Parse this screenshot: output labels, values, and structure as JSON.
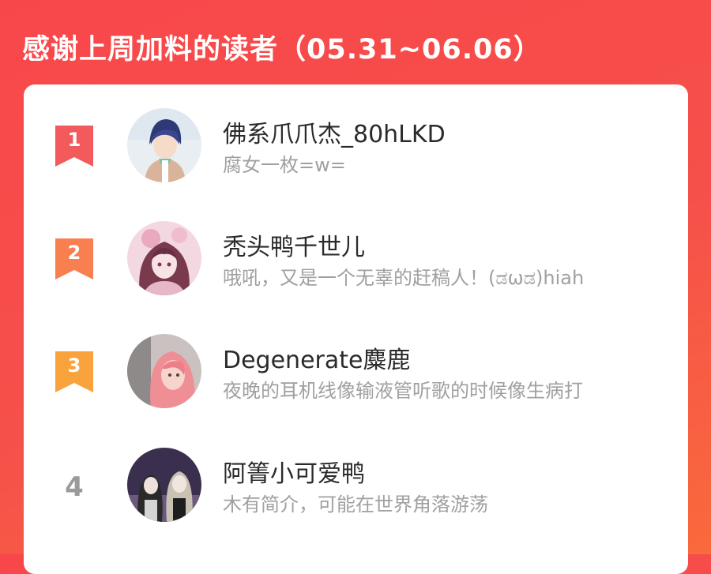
{
  "header": {
    "title": "感谢上周加料的读者（05.31~06.06）"
  },
  "colors": {
    "background": "#f6504a",
    "rank1": "#f25a5c",
    "rank2": "#f87f4f",
    "rank3": "#f8a33b",
    "rank_plain": "#9a9a9a"
  },
  "readers": [
    {
      "rank": "1",
      "name": "佛系爪爪杰_80hLKD",
      "bio": "腐女一枚=w=",
      "avatar_icon": "avatar-anime-boy-icon"
    },
    {
      "rank": "2",
      "name": "秃头鸭千世儿",
      "bio": "哦吼，又是一个无辜的赶稿人！(ಡωಡ)hiah",
      "avatar_icon": "avatar-anime-girl-pink-icon"
    },
    {
      "rank": "3",
      "name": "Degenerate麋鹿",
      "bio": "夜晚的耳机线像输液管听歌的时候像生病打",
      "avatar_icon": "avatar-pink-hair-icon"
    },
    {
      "rank": "4",
      "name": "阿箐小可爱鸭",
      "bio": "木有简介，可能在世界角落游荡",
      "avatar_icon": "avatar-group-icon"
    }
  ]
}
